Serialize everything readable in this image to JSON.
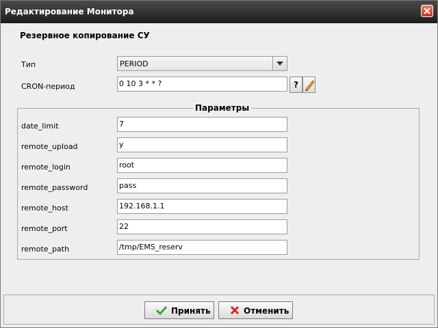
{
  "window": {
    "title": "Редактирование Монитора"
  },
  "section_title": "Резервное копирование СУ",
  "type_field": {
    "label": "Тип",
    "value": "PERIOD"
  },
  "cron_field": {
    "label": "CRON-период",
    "value": "0 10 3 * * ?",
    "help_label": "?"
  },
  "params": {
    "title": "Параметры",
    "rows": [
      {
        "label": "date_limit",
        "value": "7"
      },
      {
        "label": "remote_upload",
        "value": "y"
      },
      {
        "label": "remote_login",
        "value": "root"
      },
      {
        "label": "remote_password",
        "value": "pass"
      },
      {
        "label": "remote_host",
        "value": "192.168.1.1"
      },
      {
        "label": "remote_port",
        "value": "22"
      },
      {
        "label": "remote_path",
        "value": "/tmp/EMS_reserv"
      }
    ]
  },
  "buttons": {
    "accept": "Принять",
    "cancel": "Отменить"
  },
  "icons": {
    "close": "close-icon",
    "dropdown": "chevron-down-icon",
    "edit": "pencil-icon",
    "accept": "checkmark-icon",
    "cancel": "cross-icon"
  },
  "colors": {
    "titlebar": "#2b2b2b",
    "background": "#eeeeee",
    "accept_icon": "#3aa52a",
    "cancel_icon": "#d9261c"
  }
}
